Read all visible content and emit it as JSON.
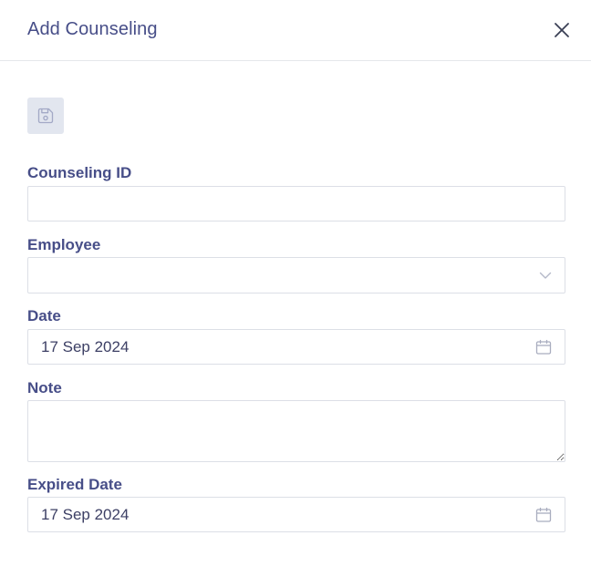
{
  "modal": {
    "title": "Add Counseling",
    "close_icon": "close-icon",
    "save_icon": "save-icon"
  },
  "form": {
    "counseling_id": {
      "label": "Counseling ID",
      "value": ""
    },
    "employee": {
      "label": "Employee",
      "value": "",
      "icon": "chevron-down-icon"
    },
    "date": {
      "label": "Date",
      "value": "17 Sep 2024",
      "icon": "calendar-icon"
    },
    "note": {
      "label": "Note",
      "value": ""
    },
    "expired_date": {
      "label": "Expired Date",
      "value": "17 Sep 2024",
      "icon": "calendar-icon"
    }
  },
  "colors": {
    "accent": "#474e88",
    "border": "#dcdfe6",
    "save_button_bg": "#e2e6ef"
  }
}
